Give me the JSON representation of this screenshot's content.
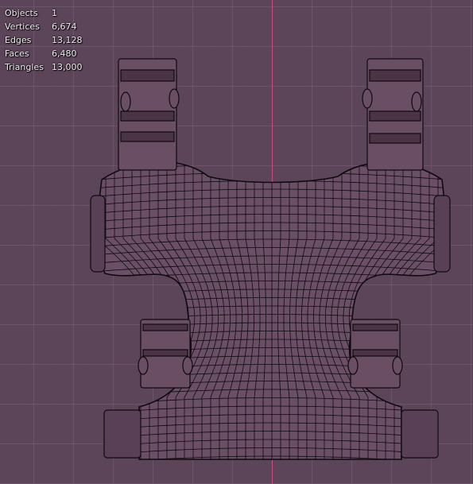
{
  "stats": [
    {
      "label": "Objects",
      "value": "1"
    },
    {
      "label": "Vertices",
      "value": "6,674"
    },
    {
      "label": "Edges",
      "value": "13,128"
    },
    {
      "label": "Faces",
      "value": "6,480"
    },
    {
      "label": "Triangles",
      "value": "13,000"
    }
  ],
  "colors": {
    "background": "#5c4459",
    "grid": "#785f76",
    "axis": "#c84e86",
    "wire": "#0e0a0e",
    "mesh_fill": "#6b4f66"
  }
}
